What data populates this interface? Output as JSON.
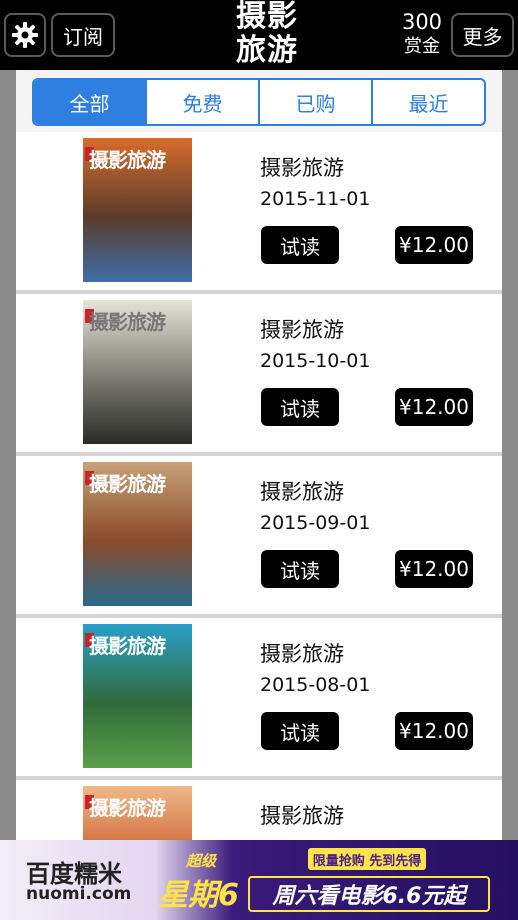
{
  "header": {
    "subscribe_label": "订阅",
    "logo_line1": "摄影",
    "logo_line2": "旅游",
    "reward_amount": "300",
    "reward_label": "赏金",
    "more_label": "更多"
  },
  "tabs": [
    {
      "label": "全部",
      "active": true
    },
    {
      "label": "免费",
      "active": false
    },
    {
      "label": "已购",
      "active": false
    },
    {
      "label": "最近",
      "active": false
    }
  ],
  "cover_masthead": "摄影旅游",
  "issues": [
    {
      "title": "摄影旅游",
      "date": "2015-11-01",
      "try_label": "试读",
      "price": "¥12.00",
      "cover_colors": [
        "#d96c2c",
        "#5a3b2a",
        "#3d6fa8"
      ]
    },
    {
      "title": "摄影旅游",
      "date": "2015-10-01",
      "try_label": "试读",
      "price": "¥12.00",
      "cover_colors": [
        "#e6e4d8",
        "#7a7a70",
        "#2a2a28"
      ]
    },
    {
      "title": "摄影旅游",
      "date": "2015-09-01",
      "try_label": "试读",
      "price": "¥12.00",
      "cover_colors": [
        "#c9a27a",
        "#8a4a2a",
        "#2a6a8a"
      ]
    },
    {
      "title": "摄影旅游",
      "date": "2015-08-01",
      "try_label": "试读",
      "price": "¥12.00",
      "cover_colors": [
        "#2aa0c8",
        "#2f6a3a",
        "#5aa04a"
      ]
    },
    {
      "title": "摄影旅游",
      "date": "",
      "try_label": "",
      "price": "",
      "cover_colors": [
        "#f0b888",
        "#c85a2a",
        "#2a4a8a"
      ]
    }
  ],
  "ad": {
    "brand": "百度糯米",
    "domain": "nuomi.com",
    "super": "超级",
    "week": "星期6",
    "tag": "限量抢购 先到先得",
    "slogan": "周六看电影6.6元起"
  }
}
